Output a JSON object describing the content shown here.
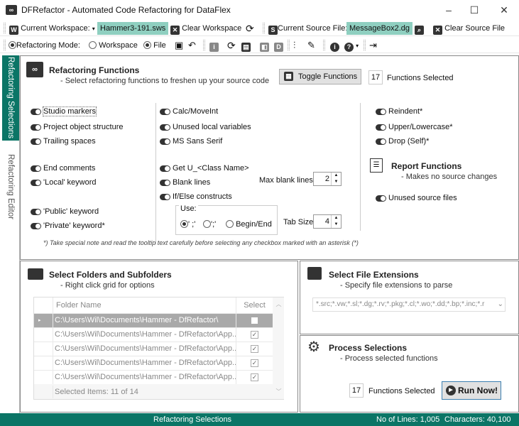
{
  "window": {
    "title": "DFRefactor - Automated Code Refactoring for DataFlex",
    "app_icon": "infinity-logo-icon"
  },
  "toolbar1": {
    "workspace_label": "Current Workspace:",
    "workspace_value": "Hammer3-191.sws",
    "clear_workspace": "Clear Workspace",
    "source_label": "Current Source File:",
    "source_value": "MessageBox2.dg",
    "clear_source": "Clear Source File"
  },
  "toolbar2": {
    "mode_label": "Refactoring Mode:",
    "mode_options": [
      "Workspace",
      "File"
    ],
    "mode_selected": "File"
  },
  "side_tabs": [
    "Refactoring Selections",
    "Refactoring Editor"
  ],
  "refactoring": {
    "title": "Refactoring Functions",
    "subtitle": "- Select refactoring functions to freshen up your source code",
    "toggle_button": "Toggle Functions",
    "selected_count": "17",
    "selected_label": "Functions Selected",
    "col1": [
      "Studio markers",
      "Project object structure",
      "Trailing spaces",
      "End comments",
      "'Local' keyword",
      "'Public' keyword",
      "'Private' keyword*"
    ],
    "col2": [
      "Calc/MoveInt",
      "Unused local variables",
      "MS Sans Serif",
      "Get U_<Class Name>",
      "Blank lines",
      "If/Else constructs"
    ],
    "col3": [
      "Reindent*",
      "Upper/Lowercase*",
      "Drop (Self)*"
    ],
    "max_blank_label": "Max blank lines",
    "max_blank_value": "2",
    "use_label": "Use:",
    "use_options": [
      "' ;'",
      "';'",
      "Begin/End"
    ],
    "use_selected": "' ;'",
    "tab_size_label": "Tab Size",
    "tab_size_value": "4",
    "report_title": "Report Functions",
    "report_subtitle": "- Makes no source changes",
    "report_items": [
      "Unused source files"
    ],
    "note": "*) Take special note and read the tooltip text carefully before selecting any checkbox marked with an asterisk (*)"
  },
  "folders": {
    "title": "Select Folders and Subfolders",
    "subtitle": "- Right click grid for options",
    "col_folder": "Folder Name",
    "col_select": "Select",
    "rows": [
      {
        "name": "C:\\Users\\Wil\\Documents\\Hammer - DfRefactor\\",
        "checked": false
      },
      {
        "name": "C:\\Users\\Wil\\Documents\\Hammer - DfRefactor\\App...",
        "checked": true
      },
      {
        "name": "C:\\Users\\Wil\\Documents\\Hammer - DfRefactor\\App...",
        "checked": true
      },
      {
        "name": "C:\\Users\\Wil\\Documents\\Hammer - DfRefactor\\App...",
        "checked": true
      },
      {
        "name": "C:\\Users\\Wil\\Documents\\Hammer - DfRefactor\\App...",
        "checked": true
      }
    ],
    "footer": "Selected Items: 11 of 14"
  },
  "extensions": {
    "title": "Select File Extensions",
    "subtitle": "- Specify file extensions to parse",
    "value": "*.src;*.vw;*.sl;*.dg;*.rv;*.pkg;*.cl;*.wo;*.dd;*.bp;*.inc;*.r"
  },
  "process": {
    "title": "Process Selections",
    "subtitle": "- Process selected functions",
    "count": "17",
    "count_label": "Functions Selected",
    "run": "Run Now!"
  },
  "status": {
    "center": "Refactoring Selections",
    "lines": "No of Lines: 1,005",
    "chars": "Characters: 40,100"
  },
  "colors": {
    "accent": "#0b7566",
    "highlight": "#8fcfc0"
  }
}
